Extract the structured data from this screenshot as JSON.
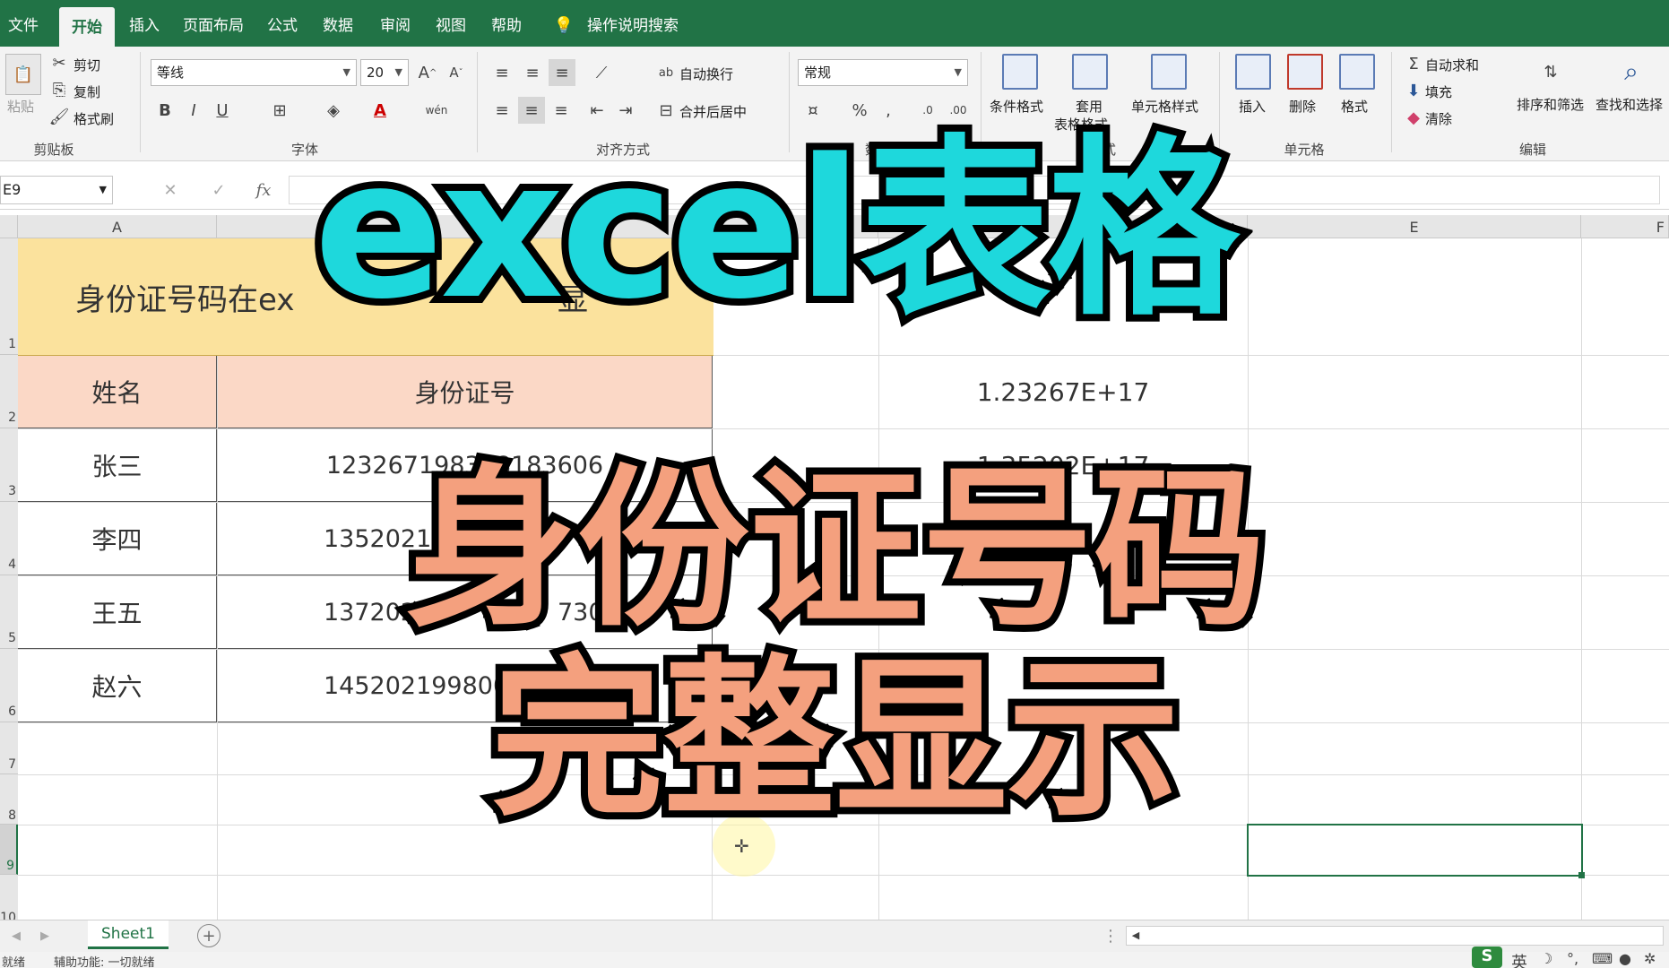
{
  "tabs": [
    "文件",
    "开始",
    "插入",
    "页面布局",
    "公式",
    "数据",
    "审阅",
    "视图",
    "帮助",
    "操作说明搜索"
  ],
  "ribbon": {
    "clipboard": {
      "paste": "粘贴",
      "cut": "剪切",
      "copy": "复制",
      "format_painter": "格式刷",
      "label": "剪贴板"
    },
    "font": {
      "name": "等线",
      "size": "20",
      "bold": "B",
      "italic": "I",
      "underline": "U",
      "font_color": "A",
      "wen": "wén",
      "label": "字体"
    },
    "align": {
      "wrap": "自动换行",
      "merge": "合并后居中",
      "label": "对齐方式"
    },
    "number": {
      "format": "常规",
      "percent": "%",
      "comma": ",",
      "inc": ".0",
      "dec": ".00",
      "label": "数字"
    },
    "styles": {
      "conditional": "条件格式",
      "table_fmt_1": "套用",
      "table_fmt_2": "表格格式",
      "cell_style": "单元格样式",
      "label": "样式"
    },
    "cells": {
      "insert": "插入",
      "delete": "删除",
      "format": "格式",
      "label": "单元格"
    },
    "editing": {
      "autosum": "自动求和",
      "fill": "填充",
      "clear": "清除",
      "sort": "排序和筛选",
      "find": "查找和选择",
      "label": "编辑"
    }
  },
  "formula_bar": {
    "name_box": "E9",
    "fx": "fx",
    "cancel": "✕",
    "enter": "✓"
  },
  "columns": [
    "A",
    "",
    "",
    "",
    "E",
    "F"
  ],
  "rows": [
    "1",
    "2",
    "3",
    "4",
    "5",
    "6",
    "7",
    "8",
    "9",
    "10"
  ],
  "sheet": {
    "title": "身份证号码在ex",
    "title_tail": "显",
    "header_name": "姓名",
    "header_id": "身份证号",
    "names": [
      "张三",
      "李四",
      "王五",
      "赵六"
    ],
    "ids": [
      "123267198308183606",
      "1352021",
      "1372021",
      "145202199800"
    ],
    "id_tail_row5": "7301",
    "sci": [
      "1.23267E+17",
      "1.35202E+17"
    ]
  },
  "tab_sheet": "Sheet1",
  "status": {
    "ready": "就绪",
    "accessibility": "辅助功能: 一切就绪"
  },
  "ime": "英",
  "overlay": {
    "line1": "excel表格",
    "line2": "身份证号码",
    "line3": "完整显示"
  },
  "colors": {
    "green": "#217346",
    "title_fill": "#fbe29d",
    "header_fill": "#fbd8c6",
    "overlay_cyan": "#1ed8dc",
    "overlay_salmon": "#f4a07e"
  }
}
